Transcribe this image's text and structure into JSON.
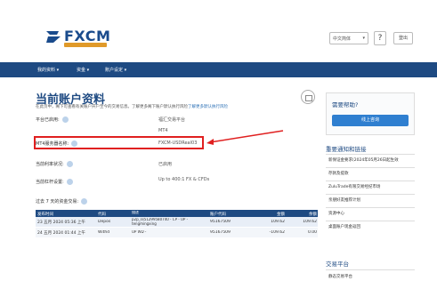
{
  "header": {
    "brand": "FXCM",
    "language": "中文简体",
    "help_label": "?",
    "logout_label": "登出"
  },
  "nav": {
    "items": [
      {
        "label": "我的资料 ▾"
      },
      {
        "label": "资金 ▾"
      },
      {
        "label": "账户设定 ▾"
      }
    ]
  },
  "main": {
    "title": "当前账户资料",
    "intro": "在此页中，阁下可查看有关账户开户至今的交易信息。了解更多阁下账户默认执行风险",
    "intro_link": "了解更多默认执行风险",
    "rows": [
      {
        "label": "平台已启用:",
        "value": "福汇交易平台"
      },
      {
        "label": "",
        "value": "MT4"
      },
      {
        "label": "MT4服务器名称:",
        "value": "FXCM-USDReal03"
      },
      {
        "label": "当前利率状况:",
        "value": "已启用"
      },
      {
        "label": "当前杠杆设置:",
        "value": "Up to 400:1 FX & CFDs"
      }
    ],
    "deposits_title": "过去 7 天的资金交易:",
    "table": {
      "headers": [
        "发布时间",
        "代码",
        "描述",
        "账户代码",
        "金额",
        "余额"
      ],
      "rows": [
        {
          "date": "23 五月 2024 05:36 上午",
          "code": "Depos",
          "desc": "p2p_ss51299580740 - CP - UP - tengmingxing",
          "account": "95167509",
          "amount": "109.62",
          "balance": "109.62"
        },
        {
          "date": "24 五月 2024 01:44 上午",
          "code": "Withd",
          "desc": "UP WD -",
          "account": "95167509",
          "amount": "-109.62",
          "balance": "0.00"
        }
      ]
    }
  },
  "sidebar": {
    "help_title": "需要帮助?",
    "chat_label": "线上咨询",
    "notice_title": "重要通知和链接",
    "notices": [
      "新保证金要求(2024年05月26日起生效",
      "存款及提款",
      "ZuluTrade有限交易经纪市场",
      "亲朋好友推荐计划",
      "资源中心",
      "桌面账户现金返回"
    ],
    "trade_title": "交易平台",
    "trade_item": "静态交易平台"
  },
  "colors": {
    "brand_blue": "#1e4a82",
    "highlight_red": "#e02020",
    "accent_orange": "#e09a2a"
  }
}
